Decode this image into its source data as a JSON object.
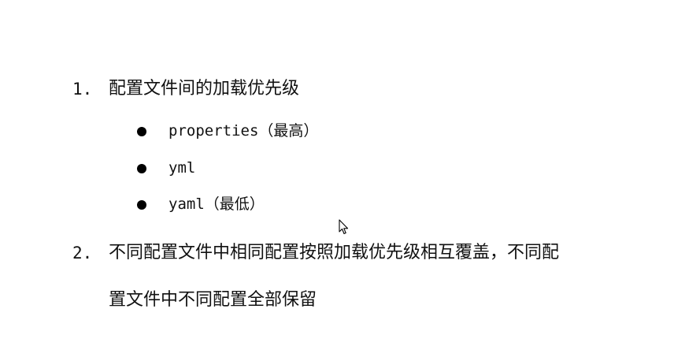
{
  "items": [
    {
      "number": "1.",
      "text": "配置文件间的加载优先级",
      "bullets": [
        "properties（最高）",
        "yml",
        "yaml（最低）"
      ]
    },
    {
      "number": "2.",
      "text_line1": "不同配置文件中相同配置按照加载优先级相互覆盖，不同配",
      "text_line2": "置文件中不同配置全部保留"
    }
  ],
  "icons": {
    "bullet": "filled-circle-icon",
    "cursor": "mouse-pointer-icon"
  }
}
